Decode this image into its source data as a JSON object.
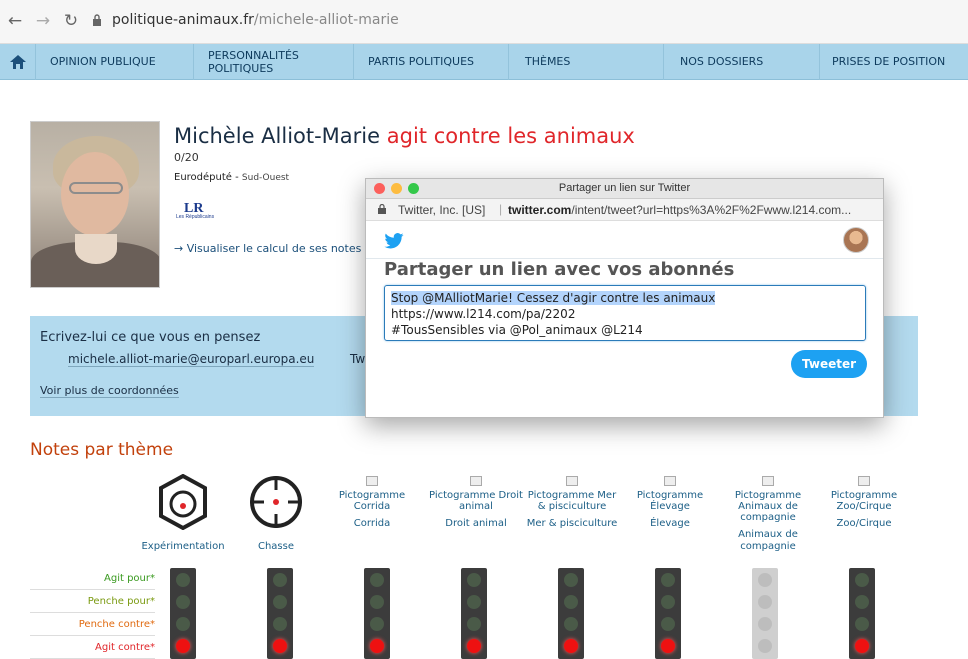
{
  "browser": {
    "back_icon": "arrow-left-icon",
    "forward_icon": "arrow-right-icon",
    "reload_icon": "reload-icon",
    "url_domain": "politique-animaux.fr",
    "url_path": "/michele-alliot-marie"
  },
  "nav": {
    "home_icon": "home-icon",
    "items": [
      {
        "label": "OPINION PUBLIQUE"
      },
      {
        "label": "PERSONNALITÉS POLITIQUES"
      },
      {
        "label": "PARTIS POLITIQUES"
      },
      {
        "label": "THÈMES"
      },
      {
        "label": "NOS DOSSIERS"
      },
      {
        "label": "PRISES DE POSITION"
      }
    ],
    "bg_color": "#a9d4ea"
  },
  "profile": {
    "name": "Michèle Alliot-Marie",
    "tagline": "agit contre les animaux",
    "score": "0/20",
    "role": "Eurodéputé",
    "region": "Sud-Ouest",
    "party_logo_text": "LR",
    "party_logo_sub": "Les Républicains",
    "calc_link": "→ Visualiser le calcul de ses notes",
    "accent_color": "#e0262a"
  },
  "contact": {
    "title": "Ecrivez-lui ce que vous en pensez",
    "email": "michele.alliot-marie@europarl.europa.eu",
    "twitter_partial": "Tw",
    "more_link": "Voir plus de coordonnées"
  },
  "notes": {
    "title": "Notes par thème",
    "themes": [
      {
        "label": "Expérimentation",
        "icon": "experimentation-icon"
      },
      {
        "label": "Chasse",
        "icon": "hunting-crosshair-icon"
      },
      {
        "alt": "Pictogramme Corrida",
        "label": "Corrida"
      },
      {
        "alt": "Pictogramme Droit animal",
        "label": "Droit animal"
      },
      {
        "alt": "Pictogramme Mer & pisciculture",
        "label": "Mer & pisciculture"
      },
      {
        "alt": "Pictogramme Élevage",
        "label": "Élevage"
      },
      {
        "alt": "Pictogramme Animaux de compagnie",
        "label": "Animaux de compagnie"
      },
      {
        "alt": "Pictogramme Zoo/Cirque",
        "label": "Zoo/Cirque"
      }
    ],
    "legend": [
      {
        "label": "Agit pour*",
        "color": "#3a9a20"
      },
      {
        "label": "Penche pour*",
        "color": "#7a9a10"
      },
      {
        "label": "Penche contre*",
        "color": "#e06a10"
      },
      {
        "label": "Agit contre*",
        "color": "#e0262a"
      }
    ]
  },
  "twitter_popup": {
    "window_title": "Partager un lien sur Twitter",
    "cert": "Twitter, Inc. [US]",
    "url_host": "twitter.com",
    "url_rest": "/intent/tweet?url=https%3A%2F%2Fwww.l214.com...",
    "heading": "Partager un lien avec vos abonnés",
    "text_highlight": "Stop @MAlliotMarie! Cessez d'agir contre les animaux",
    "text_rest_1": " https://www.l214.com/pa/2202",
    "text_rest_2": "#TousSensibles via @Pol_animaux @L214",
    "button": "Tweeter",
    "button_color": "#1da1f2"
  }
}
